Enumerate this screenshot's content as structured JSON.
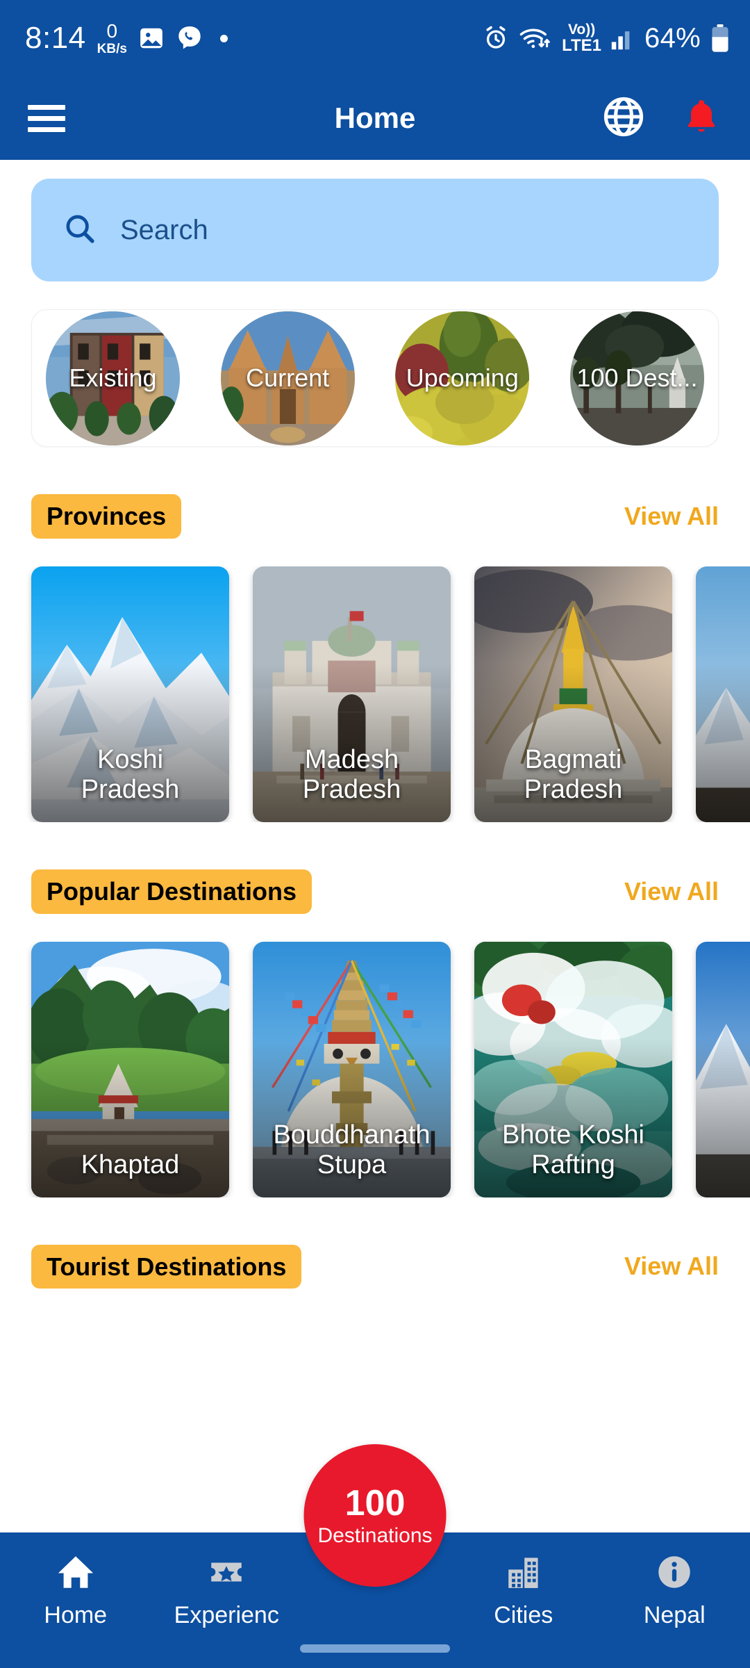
{
  "statusbar": {
    "time": "8:14",
    "net_speed_value": "0",
    "net_speed_unit": "KB/s",
    "battery_percent": "64%",
    "volte_line1": "Vo))",
    "volte_line2": "LTE1",
    "icons": [
      "photos-icon",
      "viber-icon",
      "dot-icon",
      "alarm-icon",
      "wifi-icon",
      "signal-icon",
      "battery-icon"
    ]
  },
  "appbar": {
    "title": "Home",
    "menu_icon": "hamburger-menu-icon",
    "globe_icon": "globe-icon",
    "bell_icon": "notification-bell-icon",
    "bell_color": "#f41b22"
  },
  "search": {
    "placeholder": "Search",
    "icon": "search-icon",
    "background": "#a8d5fd"
  },
  "categories": [
    {
      "label": "Existing"
    },
    {
      "label": "Current"
    },
    {
      "label": "Upcoming"
    },
    {
      "label": "100 Dest..."
    }
  ],
  "sections": [
    {
      "title": "Provinces",
      "view_all": "View All",
      "cards": [
        {
          "label": "Koshi\nPradesh",
          "line1": "Koshi",
          "line2": "Pradesh"
        },
        {
          "label": "Madesh\nPradesh",
          "line1": "Madesh",
          "line2": "Pradesh"
        },
        {
          "label": "Bagmati\nPradesh",
          "line1": "Bagmati",
          "line2": "Pradesh"
        },
        {
          "label": "",
          "line1": "",
          "line2": ""
        }
      ]
    },
    {
      "title": "Popular Destinations",
      "view_all": "View All",
      "cards": [
        {
          "label": "Khaptad",
          "line1": "Khaptad",
          "line2": ""
        },
        {
          "label": "Bouddhanath\nStupa",
          "line1": "Bouddhanath",
          "line2": "Stupa"
        },
        {
          "label": "Bhote Koshi\nRafting",
          "line1": "Bhote Koshi",
          "line2": "Rafting"
        },
        {
          "label": "",
          "line1": "",
          "line2": ""
        }
      ]
    },
    {
      "title": "Tourist Destinations",
      "view_all": "View All",
      "cards": []
    }
  ],
  "fab": {
    "count": "100",
    "label": "Destinations",
    "color": "#e8192c"
  },
  "bottomnav": {
    "items": [
      {
        "label": "Home",
        "icon": "home-icon",
        "active": true
      },
      {
        "label": "Experienc",
        "icon": "ticket-star-icon",
        "active": false
      },
      {
        "label": "Cities",
        "icon": "city-buildings-icon",
        "active": false
      },
      {
        "label": "Nepal",
        "icon": "info-icon",
        "active": false
      }
    ],
    "background": "#0d4fa0"
  },
  "theme": {
    "primary_blue": "#0d4fa0",
    "accent_amber": "#fbb940",
    "viewall_orange": "#f0a81e",
    "fab_red": "#e8192c"
  }
}
